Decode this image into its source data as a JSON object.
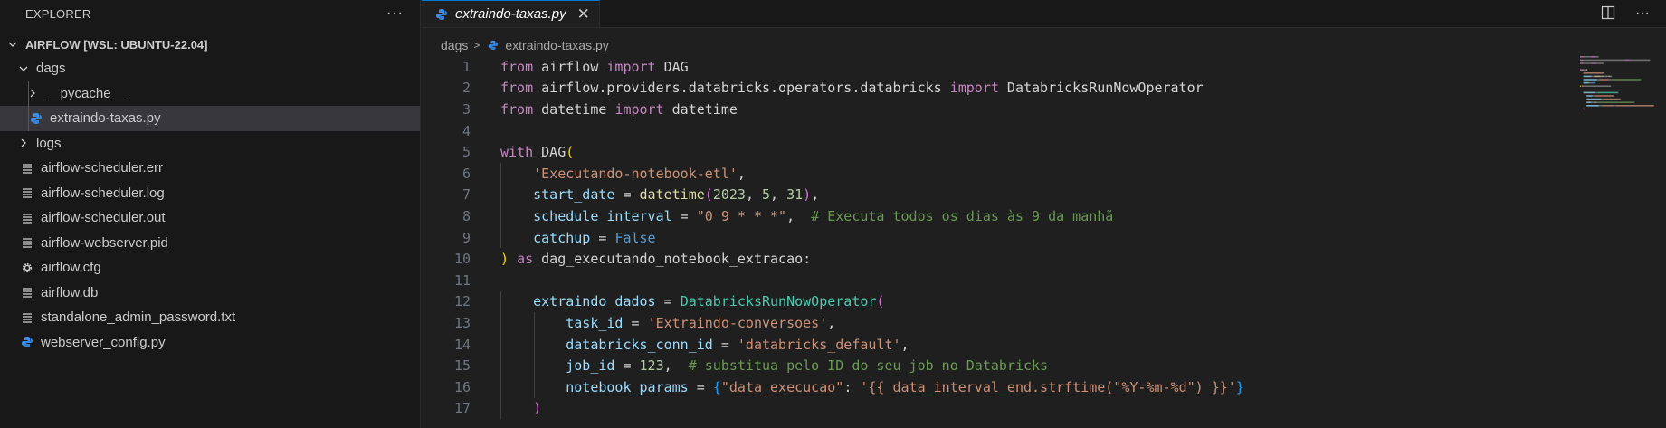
{
  "explorer": {
    "title": "EXPLORER",
    "more_label": "···",
    "root": "AIRFLOW [WSL: UBUNTU-22.04]",
    "items": [
      {
        "label": "dags",
        "type": "folder-open",
        "level": 1,
        "icon": "chevron-down-icon"
      },
      {
        "label": "__pycache__",
        "type": "folder",
        "level": 2,
        "icon": "chevron-right-icon"
      },
      {
        "label": "extraindo-taxas.py",
        "type": "python",
        "level": 2,
        "icon": "python-icon",
        "selected": true
      },
      {
        "label": "logs",
        "type": "folder",
        "level": 1,
        "icon": "chevron-right-icon"
      },
      {
        "label": "airflow-scheduler.err",
        "type": "text",
        "level": 1,
        "icon": "lines-icon"
      },
      {
        "label": "airflow-scheduler.log",
        "type": "text",
        "level": 1,
        "icon": "lines-icon"
      },
      {
        "label": "airflow-scheduler.out",
        "type": "text",
        "level": 1,
        "icon": "lines-icon"
      },
      {
        "label": "airflow-webserver.pid",
        "type": "text",
        "level": 1,
        "icon": "lines-icon"
      },
      {
        "label": "airflow.cfg",
        "type": "config",
        "level": 1,
        "icon": "gear-icon"
      },
      {
        "label": "airflow.db",
        "type": "text",
        "level": 1,
        "icon": "lines-icon"
      },
      {
        "label": "standalone_admin_password.txt",
        "type": "text",
        "level": 1,
        "icon": "lines-icon"
      },
      {
        "label": "webserver_config.py",
        "type": "python",
        "level": 1,
        "icon": "python-icon"
      }
    ]
  },
  "editor": {
    "tab_label": "extraindo-taxas.py",
    "tab_close": "✕",
    "breadcrumb": [
      "dags",
      "extraindo-taxas.py"
    ],
    "line_numbers": [
      "1",
      "2",
      "3",
      "4",
      "5",
      "6",
      "7",
      "8",
      "9",
      "10",
      "11",
      "12",
      "13",
      "14",
      "15",
      "16",
      "17"
    ],
    "code": [
      [
        [
          "kw",
          "from"
        ],
        [
          "plain",
          " airflow "
        ],
        [
          "kw",
          "import"
        ],
        [
          "plain",
          " DAG"
        ]
      ],
      [
        [
          "kw",
          "from"
        ],
        [
          "plain",
          " airflow.providers.databricks.operators.databricks "
        ],
        [
          "kw",
          "import"
        ],
        [
          "plain",
          " DatabricksRunNowOperator"
        ]
      ],
      [
        [
          "kw",
          "from"
        ],
        [
          "plain",
          " datetime "
        ],
        [
          "kw",
          "import"
        ],
        [
          "plain",
          " datetime"
        ]
      ],
      [],
      [
        [
          "kw",
          "with"
        ],
        [
          "plain",
          " DAG"
        ],
        [
          "br1",
          "("
        ]
      ],
      [
        [
          "plain",
          "    "
        ],
        [
          "str",
          "'Executando-notebook-etl'"
        ],
        [
          "plain",
          ","
        ]
      ],
      [
        [
          "plain",
          "    "
        ],
        [
          "var",
          "start_date"
        ],
        [
          "plain",
          " = "
        ],
        [
          "fn",
          "datetime"
        ],
        [
          "br2",
          "("
        ],
        [
          "num",
          "2023"
        ],
        [
          "plain",
          ", "
        ],
        [
          "num",
          "5"
        ],
        [
          "plain",
          ", "
        ],
        [
          "num",
          "31"
        ],
        [
          "br2",
          ")"
        ],
        [
          "plain",
          ","
        ]
      ],
      [
        [
          "plain",
          "    "
        ],
        [
          "var",
          "schedule_interval"
        ],
        [
          "plain",
          " = "
        ],
        [
          "str",
          "\"0 9 * * *\""
        ],
        [
          "plain",
          ",  "
        ],
        [
          "cmt",
          "# Executa todos os dias às 9 da manhã"
        ]
      ],
      [
        [
          "plain",
          "    "
        ],
        [
          "var",
          "catchup"
        ],
        [
          "plain",
          " = "
        ],
        [
          "kw2",
          "False"
        ]
      ],
      [
        [
          "br1",
          ")"
        ],
        [
          "plain",
          " "
        ],
        [
          "kw",
          "as"
        ],
        [
          "plain",
          " dag_executando_notebook_extracao:"
        ]
      ],
      [],
      [
        [
          "plain",
          "    "
        ],
        [
          "var",
          "extraindo_dados"
        ],
        [
          "plain",
          " = "
        ],
        [
          "cls",
          "DatabricksRunNowOperator"
        ],
        [
          "br2",
          "("
        ]
      ],
      [
        [
          "plain",
          "        "
        ],
        [
          "var",
          "task_id"
        ],
        [
          "plain",
          " = "
        ],
        [
          "str",
          "'Extraindo-conversoes'"
        ],
        [
          "plain",
          ","
        ]
      ],
      [
        [
          "plain",
          "        "
        ],
        [
          "var",
          "databricks_conn_id"
        ],
        [
          "plain",
          " = "
        ],
        [
          "str",
          "'databricks_default'"
        ],
        [
          "plain",
          ","
        ]
      ],
      [
        [
          "plain",
          "        "
        ],
        [
          "var",
          "job_id"
        ],
        [
          "plain",
          " = "
        ],
        [
          "num",
          "123"
        ],
        [
          "plain",
          ",  "
        ],
        [
          "cmt",
          "# substitua pelo ID do seu job no Databricks"
        ]
      ],
      [
        [
          "plain",
          "        "
        ],
        [
          "var",
          "notebook_params"
        ],
        [
          "plain",
          " = "
        ],
        [
          "br3",
          "{"
        ],
        [
          "str",
          "\"data_execucao\""
        ],
        [
          "plain",
          ": "
        ],
        [
          "str",
          "'{{ data_interval_end.strftime(\"%Y-%m-%d\") }}'"
        ],
        [
          "br3",
          "}"
        ]
      ],
      [
        [
          "plain",
          "    "
        ],
        [
          "br2",
          ")"
        ]
      ]
    ]
  },
  "colors": {
    "accent": "#0078d4",
    "python": "#3b8eea",
    "keyword": "#c586c0",
    "string": "#ce9178"
  }
}
